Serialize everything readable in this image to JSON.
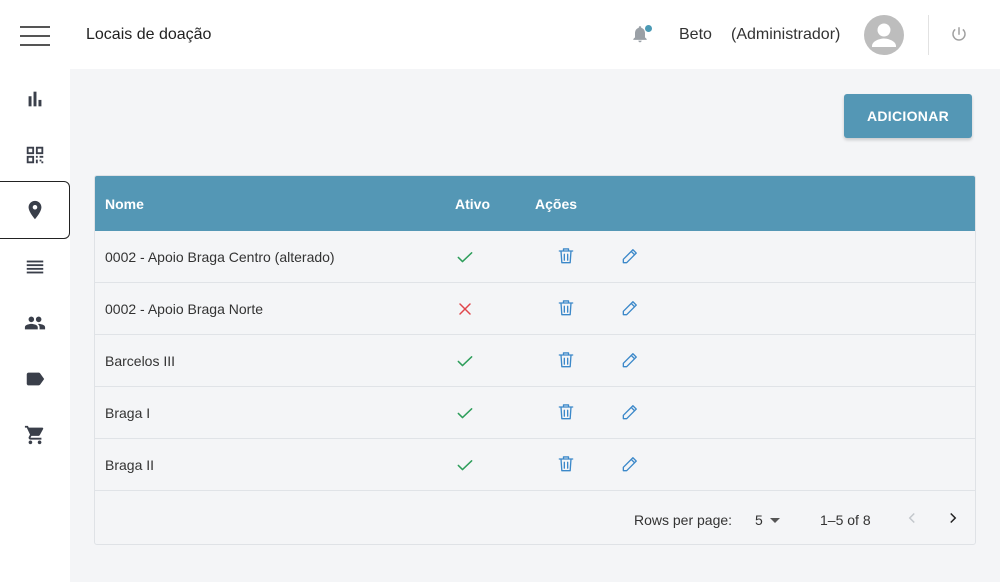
{
  "page": {
    "title": "Locais de doação"
  },
  "header": {
    "user_name": "Beto",
    "user_role": "(Administrador)",
    "notification_dot_color": "#4b9ab5"
  },
  "sidebar": {
    "items": [
      {
        "icon": "bar-chart-icon"
      },
      {
        "icon": "qr-code-icon"
      },
      {
        "icon": "location-pin-icon",
        "active": true
      },
      {
        "icon": "list-icon"
      },
      {
        "icon": "people-icon"
      },
      {
        "icon": "label-icon"
      },
      {
        "icon": "cart-icon"
      }
    ]
  },
  "toolbar": {
    "add_label": "ADICIONAR"
  },
  "table": {
    "headers": {
      "name": "Nome",
      "active": "Ativo",
      "actions": "Ações"
    },
    "rows": [
      {
        "name": "0002 - Apoio Braga Centro (alterado)",
        "active": true
      },
      {
        "name": "0002 - Apoio Braga Norte",
        "active": false
      },
      {
        "name": "Barcelos III",
        "active": true
      },
      {
        "name": "Braga I",
        "active": true
      },
      {
        "name": "Braga II",
        "active": true
      }
    ]
  },
  "pagination": {
    "rows_per_page_label": "Rows per page:",
    "rows_per_page_value": "5",
    "range_label": "1–5 of 8"
  },
  "colors": {
    "accent": "#5497b5",
    "active_check": "#2e9e5b",
    "inactive_cross": "#e0464b",
    "action_icon": "#3b88c9"
  }
}
